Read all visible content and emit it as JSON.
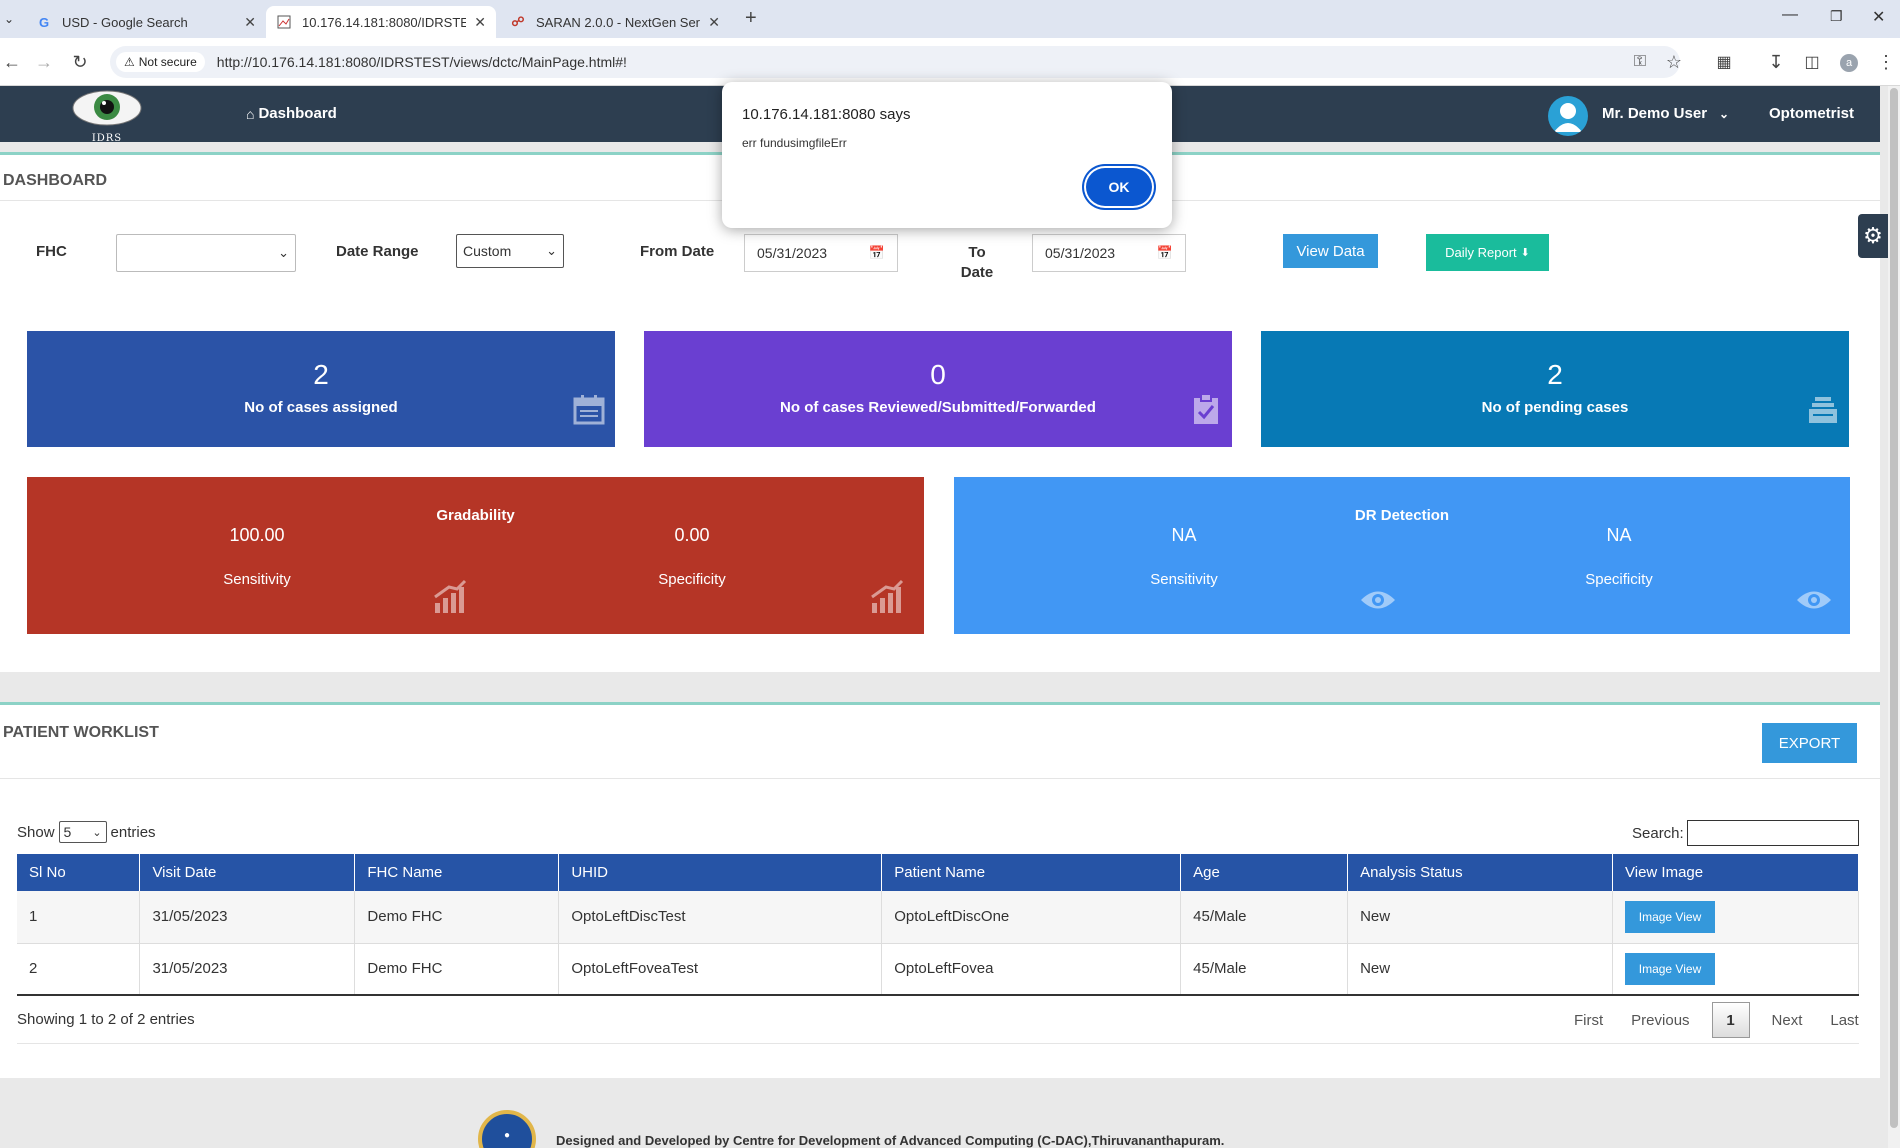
{
  "browser": {
    "tabs": [
      {
        "title": "USD - Google Search",
        "icon": "google-icon"
      },
      {
        "title": "10.176.14.181:8080/IDRSTEST/v",
        "icon": "page-icon"
      },
      {
        "title": "SARAN 2.0.0 - NextGen Service",
        "icon": "headset-icon"
      }
    ],
    "security_chip": "Not secure",
    "url": "http://10.176.14.181:8080/IDRSTEST/views/dctc/MainPage.html#!"
  },
  "header": {
    "logo_text": "IDRS",
    "nav_dashboard": "Dashboard",
    "user_name": "Mr. Demo User",
    "role": "Optometrist"
  },
  "dialog": {
    "title": "10.176.14.181:8080 says",
    "message": "err fundusimgfileErr",
    "ok_label": "OK"
  },
  "dashboard": {
    "title": "DASHBOARD",
    "fhc_label": "FHC",
    "fhc_value": "",
    "date_range_label": "Date Range",
    "date_range_value": "Custom",
    "from_date_label": "From Date",
    "from_date_value": "05/31/2023",
    "to_date_label": "To Date",
    "to_date_value": "05/31/2023",
    "view_data_label": "View Data",
    "daily_report_label": "Daily Report",
    "cards": [
      {
        "value": "2",
        "label": "No of cases assigned",
        "color": "#2b53a7"
      },
      {
        "value": "0",
        "label": "No of cases Reviewed/Submitted/Forwarded",
        "color": "#6a3fd1"
      },
      {
        "value": "2",
        "label": "No of pending cases",
        "color": "#0779b5"
      }
    ],
    "gradability": {
      "title": "Gradability",
      "sensitivity_value": "100.00",
      "sensitivity_label": "Sensitivity",
      "specificity_value": "0.00",
      "specificity_label": "Specificity",
      "color": "#b53526"
    },
    "dr_detection": {
      "title": "DR Detection",
      "sensitivity_value": "NA",
      "sensitivity_label": "Sensitivity",
      "specificity_value": "NA",
      "specificity_label": "Specificity",
      "color": "#4197f4"
    }
  },
  "worklist": {
    "title": "PATIENT WORKLIST",
    "export_label": "EXPORT",
    "show_label": "Show",
    "entries_value": "5",
    "entries_label": "entries",
    "search_label": "Search:",
    "search_value": "",
    "columns": [
      "Sl No",
      "Visit Date",
      "FHC Name",
      "UHID",
      "Patient Name",
      "Age",
      "Analysis Status",
      "View Image"
    ],
    "rows": [
      {
        "sl": "1",
        "visit_date": "31/05/2023",
        "fhc": "Demo FHC",
        "uhid": "OptoLeftDiscTest",
        "patient": "OptoLeftDiscOne",
        "age": "45/Male",
        "status": "New",
        "action": "Image View"
      },
      {
        "sl": "2",
        "visit_date": "31/05/2023",
        "fhc": "Demo FHC",
        "uhid": "OptoLeftFoveaTest",
        "patient": "OptoLeftFovea",
        "age": "45/Male",
        "status": "New",
        "action": "Image View"
      }
    ],
    "showing_text": "Showing 1 to 2 of 2 entries",
    "pager": {
      "first": "First",
      "previous": "Previous",
      "current": "1",
      "next": "Next",
      "last": "Last"
    }
  },
  "footer": {
    "credit": "Designed and Developed by Centre for Development of Advanced Computing (C-DAC),Thiruvananthapuram."
  }
}
